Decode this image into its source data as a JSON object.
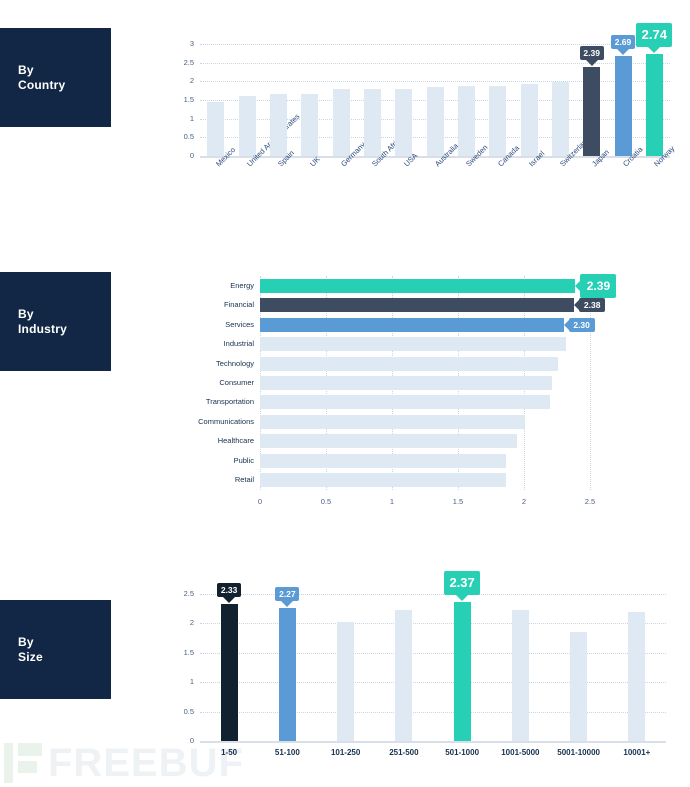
{
  "watermark": {
    "text": "FREEBUF"
  },
  "palette": {
    "panel_bg": "#122745",
    "teal": "#27d0b4",
    "blue": "#5b9bd5",
    "navy": "#3e4c62",
    "dark": "#12212f",
    "pale": "#dfe9f4",
    "grid": "#c9d4e2",
    "axis_text": "#4a5f86"
  },
  "sections": [
    {
      "id": "by-country",
      "label": "By\nCountry"
    },
    {
      "id": "by-industry",
      "label": "By\nIndustry"
    },
    {
      "id": "by-size",
      "label": "By\nSize"
    }
  ],
  "chart_data": [
    {
      "type": "bar",
      "id": "by-country",
      "title": "By Country",
      "xlabel": "",
      "ylabel": "",
      "ylim": [
        0,
        3
      ],
      "yticks": [
        "0",
        "0.5",
        "1",
        "1.5",
        "2",
        "2.5",
        "3"
      ],
      "grid": true,
      "categories": [
        "Mexico",
        "United Arab Emirates",
        "Spain",
        "UK",
        "Germany",
        "South Africa",
        "USA",
        "Australia",
        "Sweden",
        "Canada",
        "Israel",
        "Switzerland",
        "Japan",
        "Croatia",
        "Norway"
      ],
      "values": [
        1.45,
        1.62,
        1.66,
        1.66,
        1.8,
        1.8,
        1.8,
        1.85,
        1.87,
        1.87,
        1.93,
        1.98,
        2.39,
        2.69,
        2.74
      ],
      "colors": [
        "pale",
        "pale",
        "pale",
        "pale",
        "pale",
        "pale",
        "pale",
        "pale",
        "pale",
        "pale",
        "pale",
        "pale",
        "navy",
        "blue",
        "teal"
      ],
      "labels": [
        null,
        null,
        null,
        null,
        null,
        null,
        null,
        null,
        null,
        null,
        null,
        null,
        "2.39",
        "2.69",
        "2.74"
      ]
    },
    {
      "type": "bar",
      "id": "by-industry",
      "title": "By Industry",
      "orientation": "horizontal",
      "xlabel": "",
      "ylabel": "",
      "xlim": [
        0,
        2.5
      ],
      "xticks": [
        "0",
        "0.5",
        "1",
        "1.5",
        "2",
        "2.5"
      ],
      "grid": true,
      "categories": [
        "Energy",
        "Financial",
        "Services",
        "Industrial",
        "Technology",
        "Consumer",
        "Transportation",
        "Communications",
        "Healthcare",
        "Public",
        "Retail"
      ],
      "values": [
        2.39,
        2.38,
        2.3,
        2.32,
        2.26,
        2.21,
        2.2,
        2.01,
        1.95,
        1.86,
        1.86
      ],
      "colors": [
        "teal",
        "navy",
        "blue",
        "pale",
        "pale",
        "pale",
        "pale",
        "pale",
        "pale",
        "pale",
        "pale"
      ],
      "labels": [
        "2.39",
        "2.38",
        "2.30",
        null,
        null,
        null,
        null,
        null,
        null,
        null,
        null
      ]
    },
    {
      "type": "bar",
      "id": "by-size",
      "title": "By Size",
      "xlabel": "",
      "ylabel": "",
      "ylim": [
        0,
        2.5
      ],
      "yticks": [
        "0",
        "0.5",
        "1",
        "1.5",
        "2",
        "2.5"
      ],
      "grid": true,
      "categories": [
        "1-50",
        "51-100",
        "101-250",
        "251-500",
        "501-1000",
        "1001-5000",
        "5001-10000",
        "10001+"
      ],
      "values": [
        2.33,
        2.27,
        2.02,
        2.22,
        2.37,
        2.22,
        1.86,
        2.2
      ],
      "colors": [
        "dark",
        "blue",
        "pale",
        "pale",
        "teal",
        "pale",
        "pale",
        "pale"
      ],
      "labels": [
        "2.33",
        "2.27",
        null,
        null,
        "2.37",
        null,
        null,
        null
      ]
    }
  ]
}
